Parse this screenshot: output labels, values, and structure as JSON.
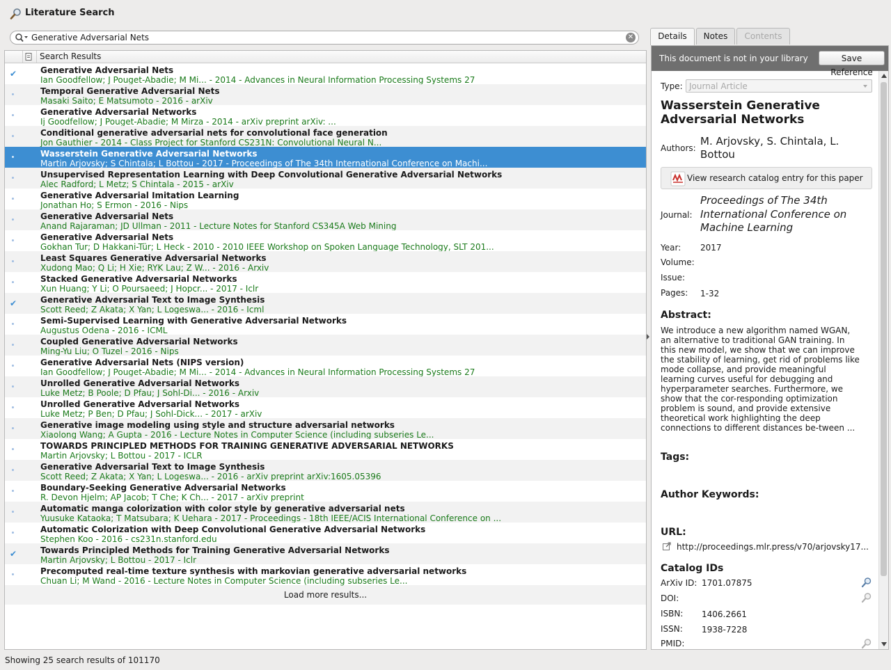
{
  "window": {
    "title": "Literature Search"
  },
  "search": {
    "query": "Generative Adversarial Nets"
  },
  "list": {
    "column_header": "Search Results",
    "load_more": "Load more results...",
    "rows": [
      {
        "title": "Generative Adversarial Nets",
        "sub": "Ian Goodfellow; J Pouget-Abadie; M Mi... - 2014 - Advances in Neural Information Processing Systems 27",
        "mark": "check"
      },
      {
        "title": "Temporal Generative Adversarial Nets",
        "sub": "Masaki Saito; E Matsumoto - 2016 - arXiv",
        "mark": "dot"
      },
      {
        "title": "Generative Adversarial Networks",
        "sub": "Ij Goodfellow; J Pouget-Abadie; M Mirza - 2014 - arXiv preprint arXiv: ...",
        "mark": "dot"
      },
      {
        "title": "Conditional generative adversarial nets for convolutional face generation",
        "sub": "Jon Gauthier - 2014 - Class Project for Stanford CS231N: Convolutional Neural N...",
        "mark": "dot"
      },
      {
        "title": "Wasserstein Generative Adversarial Networks",
        "sub": "Martin Arjovsky; S Chintala; L Bottou - 2017 - Proceedings of The 34th International Conference on Machi...",
        "mark": "dot",
        "selected": true
      },
      {
        "title": "Unsupervised Representation Learning with Deep Convolutional Generative Adversarial Networks",
        "sub": "Alec Radford; L Metz; S Chintala - 2015 - arXiv",
        "mark": "dot"
      },
      {
        "title": "Generative Adversarial Imitation Learning",
        "sub": "Jonathan Ho; S Ermon - 2016 - Nips",
        "mark": "dot"
      },
      {
        "title": "Generative Adversarial Nets",
        "sub": "Anand Rajaraman; JD Ullman - 2011 - Lecture Notes for Stanford CS345A Web Mining",
        "mark": "dot"
      },
      {
        "title": "Generative Adversarial Nets",
        "sub": "Gokhan Tur; D Hakkani-Tür; L Heck - 2010 - 2010 IEEE Workshop on Spoken Language Technology, SLT 201...",
        "mark": "dot"
      },
      {
        "title": "Least Squares Generative Adversarial Networks",
        "sub": "Xudong Mao; Q Li; H Xie; RYK Lau; Z W... - 2016 - Arxiv",
        "mark": "dot"
      },
      {
        "title": "Stacked Generative Adversarial Networks",
        "sub": "Xun Huang; Y Li; O Poursaeed; J Hopcr... - 2017 - Iclr",
        "mark": "dot"
      },
      {
        "title": "Generative Adversarial Text to Image Synthesis",
        "sub": "Scott Reed; Z Akata; X Yan; L Logeswa... - 2016 - Icml",
        "mark": "check"
      },
      {
        "title": "Semi-Supervised Learning with Generative Adversarial Networks",
        "sub": "Augustus Odena - 2016 - ICML",
        "mark": "dot"
      },
      {
        "title": "Coupled Generative Adversarial Networks",
        "sub": "Ming-Yu Liu; O Tuzel - 2016 - Nips",
        "mark": "dot"
      },
      {
        "title": "Generative Adversarial Nets (NIPS version)",
        "sub": "Ian Goodfellow; J Pouget-Abadie; M Mi... - 2014 - Advances in Neural Information Processing Systems 27",
        "mark": "dot"
      },
      {
        "title": "Unrolled Generative Adversarial Networks",
        "sub": "Luke Metz; B Poole; D Pfau; J Sohl-Di... - 2016 - Arxiv",
        "mark": "dot"
      },
      {
        "title": "Unrolled Generative Adversarial Networks",
        "sub": "Luke Metz; P Ben; D Pfau; J Sohl-Dick... - 2017 - arXiv",
        "mark": "dot"
      },
      {
        "title": "Generative image modeling using style and structure adversarial networks",
        "sub": "Xiaolong Wang; A Gupta - 2016 - Lecture Notes in Computer Science (including subseries Le...",
        "mark": "dot"
      },
      {
        "title": "TOWARDS PRINCIPLED METHODS FOR TRAINING GENERATIVE ADVERSARIAL NETWORKS",
        "sub": "Martin Arjovsky; L Bottou - 2017 - ICLR",
        "mark": "dot"
      },
      {
        "title": "Generative Adversarial Text to Image Synthesis",
        "sub": "Scott Reed; Z Akata; X Yan; L Logeswa... - 2016 - arXiv preprint arXiv:1605.05396",
        "mark": "dot"
      },
      {
        "title": "Boundary-Seeking Generative Adversarial Networks",
        "sub": "R. Devon Hjelm; AP Jacob; T Che; K Ch... - 2017 - arXiv preprint",
        "mark": "dot"
      },
      {
        "title": "Automatic manga colorization with color style by generative adversarial nets",
        "sub": "Yuusuke Kataoka; T Matsubara; K Uehara - 2017 - Proceedings - 18th IEEE/ACIS International Conference on ...",
        "mark": "dot"
      },
      {
        "title": "Automatic Colorization with Deep Convolutional Generative Adversarial Networks",
        "sub": "Stephen Koo - 2016 - cs231n.stanford.edu",
        "mark": "dot"
      },
      {
        "title": "Towards Principled Methods for Training Generative Adversarial Networks",
        "sub": "Martin Arjovsky; L Bottou - 2017 - Iclr",
        "mark": "check"
      },
      {
        "title": "Precomputed real-time texture synthesis with markovian generative adversarial networks",
        "sub": "Chuan Li; M Wand - 2016 - Lecture Notes in Computer Science (including subseries Le...",
        "mark": "dot"
      }
    ]
  },
  "tabs": [
    {
      "label": "Details",
      "state": "active"
    },
    {
      "label": "Notes",
      "state": "normal"
    },
    {
      "label": "Contents",
      "state": "disabled"
    }
  ],
  "details": {
    "banner_text": "This document is not in your library",
    "save_button": "Save Reference",
    "type_label": "Type:",
    "type_value": "Journal Article",
    "title": "Wasserstein Generative Adversarial Networks",
    "authors_label": "Authors:",
    "authors": "M. Arjovsky, S. Chintala, L. Bottou",
    "catalog_button": "View research catalog entry for this paper",
    "journal_label": "Journal:",
    "journal": "Proceedings of The 34th International Conference on Machine Learning",
    "year_label": "Year:",
    "year": "2017",
    "volume_label": "Volume:",
    "issue_label": "Issue:",
    "pages_label": "Pages:",
    "pages": "1-32",
    "abstract_heading": "Abstract:",
    "abstract": "We introduce a new algorithm named WGAN, an alternative to traditional GAN training. In this new model, we show that we can improve the stability of learning, get rid of problems like mode collapse, and provide meaningful learning curves useful for debugging and hyperparameter searches. Furthermore, we show that the cor-responding optimization problem is sound, and provide extensive theoretical work highlighting the deep connections to different distances be-tween ...",
    "tags_heading": "Tags:",
    "keywords_heading": "Author Keywords:",
    "url_heading": "URL:",
    "url": "http://proceedings.mlr.press/v70/arjovsky17...",
    "catalog_heading": "Catalog IDs",
    "arxiv_label": "ArXiv ID:",
    "arxiv": "1701.07875",
    "doi_label": "DOI:",
    "isbn_label": "ISBN:",
    "isbn": "1406.2661",
    "issn_label": "ISSN:",
    "issn": "1938-7228",
    "pmid_label": "PMID:"
  },
  "status": {
    "text": "Showing 25 search results of 101170"
  },
  "colors": {
    "selection": "#3d8ed2",
    "subtitle_green": "#1a7a1a",
    "banner": "#6f6f6f"
  }
}
